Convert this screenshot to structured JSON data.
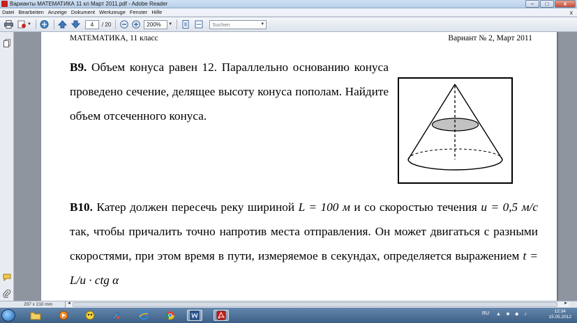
{
  "window": {
    "title": "Варианты МАТЕМАТИКА 11 кл Март 2011.pdf - Adobe Reader",
    "minimize": "–",
    "maximize": "□",
    "close": "x"
  },
  "menu": {
    "items": [
      "Datei",
      "Bearbeiten",
      "Anzeige",
      "Dokument",
      "Werkzeuge",
      "Fenster",
      "Hilfe"
    ],
    "close_doc": "x"
  },
  "toolbar": {
    "page_current": "4",
    "page_total": "/ 20",
    "zoom": "200%",
    "search_placeholder": "Suchen"
  },
  "document": {
    "header_left": "МАТЕМАТИКА, 11 класс",
    "header_right": "Вариант № 2, Март 2011",
    "b9": {
      "label": "В9.",
      "text": "Объем конуса равен 12. Параллельно основанию конуса проведено сечение, делящее высоту конуса пополам. Найдите объем отсеченного конуса."
    },
    "b10": {
      "label": "В10.",
      "text1": "Катер должен пересечь реку шириной",
      "L_eq": "L = 100 м",
      "text2": "и со скоростью течения",
      "u_eq": "u = 0,5 м/с",
      "text3": "так, чтобы причалить точно напротив места отправления. Он может двигаться с разными скоростями, при этом время в пути, измеряемое в секундах, определяется выражением",
      "formula": "t = L/u · ctg α"
    }
  },
  "status": {
    "page_size": "297 x 210 mm"
  },
  "taskbar": {
    "apps": [
      "explorer-icon",
      "media-icon",
      "gimp-icon",
      "paint-icon",
      "ie-icon",
      "chrome-icon",
      "word-icon",
      "adobe-reader-icon"
    ],
    "lang": "RU",
    "time": "12:34",
    "date": "15.05.2012"
  }
}
